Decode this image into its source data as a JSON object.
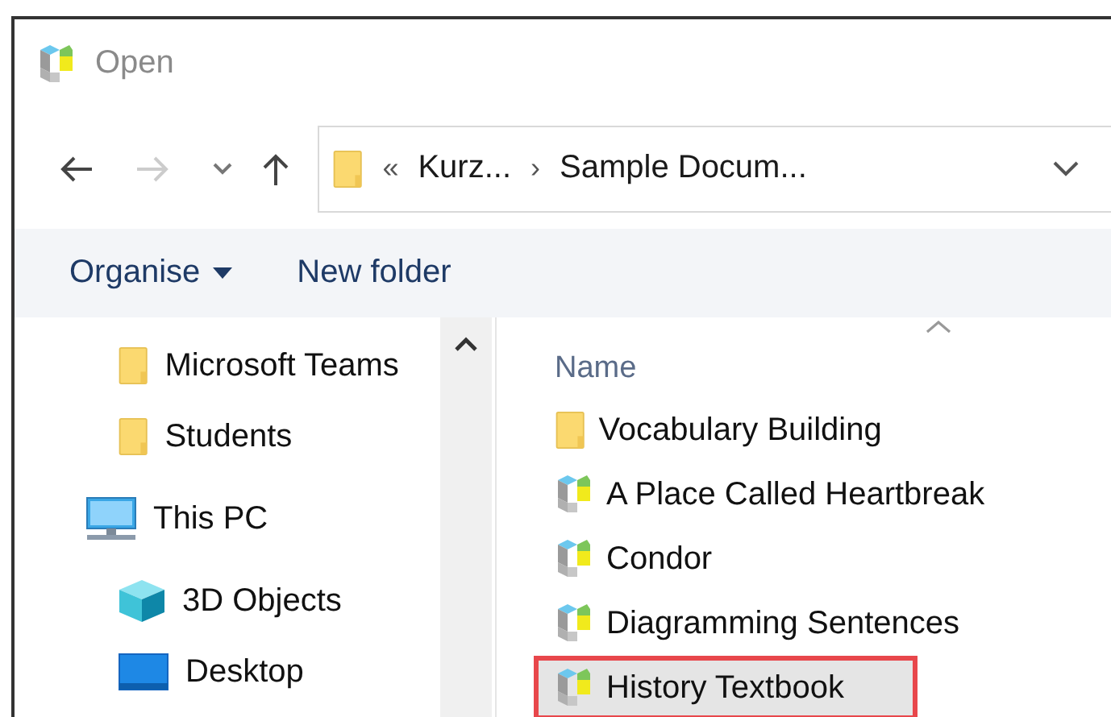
{
  "window": {
    "title": "Open"
  },
  "navigation": {
    "back": {
      "disabled": false
    },
    "forward": {
      "disabled": true
    }
  },
  "address_bar": {
    "overflow": "«",
    "segments": [
      "Kurz...",
      "Sample Docum..."
    ],
    "separator": "›"
  },
  "toolbar": {
    "items": [
      {
        "label": "Organise",
        "has_menu": true
      },
      {
        "label": "New folder",
        "has_menu": false
      }
    ]
  },
  "sidebar": {
    "items": [
      {
        "label": "Microsoft Teams",
        "kind": "folder",
        "indent": true
      },
      {
        "label": "Students",
        "kind": "folder",
        "indent": true
      },
      {
        "label": "This PC",
        "kind": "pc",
        "indent": false
      },
      {
        "label": "3D Objects",
        "kind": "objects",
        "indent": true
      },
      {
        "label": "Desktop",
        "kind": "desktop",
        "indent": true
      }
    ]
  },
  "file_list": {
    "column": "Name",
    "rows": [
      {
        "name": "Vocabulary Building",
        "kind": "folder",
        "selected": false,
        "highlighted": false
      },
      {
        "name": "A Place Called Heartbreak",
        "kind": "document",
        "selected": false,
        "highlighted": false
      },
      {
        "name": "Condor",
        "kind": "document",
        "selected": false,
        "highlighted": false
      },
      {
        "name": "Diagramming Sentences",
        "kind": "document",
        "selected": false,
        "highlighted": false
      },
      {
        "name": "History Textbook",
        "kind": "document",
        "selected": true,
        "highlighted": true
      }
    ]
  }
}
